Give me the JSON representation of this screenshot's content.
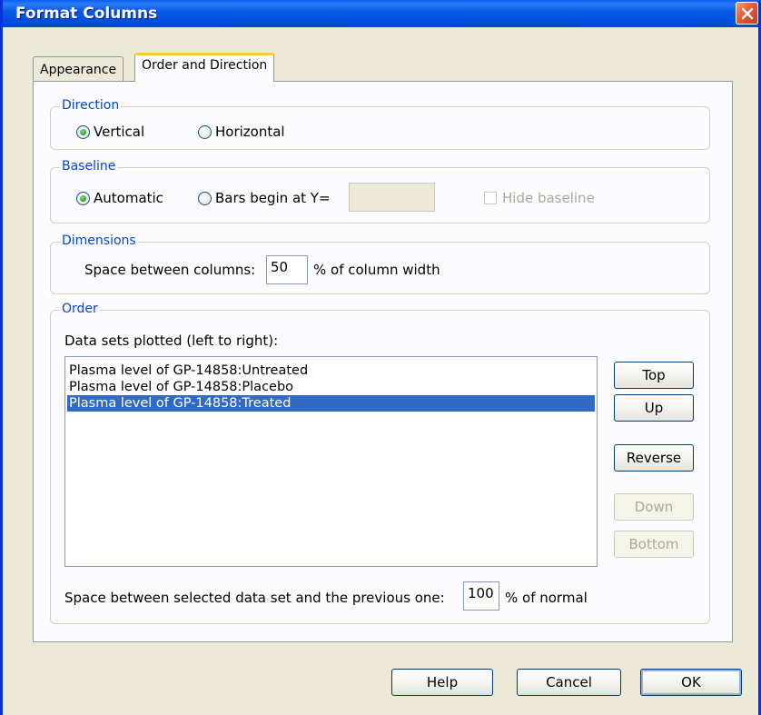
{
  "window": {
    "title": "Format Columns"
  },
  "tabs": [
    {
      "label": "Appearance",
      "active": false
    },
    {
      "label": "Order and Direction",
      "active": true
    }
  ],
  "direction": {
    "label": "Direction",
    "options": [
      {
        "label": "Vertical",
        "selected": true
      },
      {
        "label": "Horizontal",
        "selected": false
      }
    ]
  },
  "baseline": {
    "label": "Baseline",
    "automatic_label": "Automatic",
    "bars_begin_label": "Bars begin at Y=",
    "bars_begin_value": "",
    "hide_baseline_label": "Hide baseline",
    "selected": "Automatic"
  },
  "dimensions": {
    "label": "Dimensions",
    "space_label": "Space between columns:",
    "space_value": "50",
    "space_unit": "% of column width"
  },
  "order": {
    "label": "Order",
    "list_label": "Data sets plotted (left to right):",
    "items": [
      {
        "label": "Plasma level of GP-14858:Untreated",
        "selected": false
      },
      {
        "label": "Plasma level of GP-14858:Placebo",
        "selected": false
      },
      {
        "label": "Plasma level of GP-14858:Treated",
        "selected": true
      }
    ],
    "buttons": {
      "top": "Top",
      "up": "Up",
      "reverse": "Reverse",
      "down": "Down",
      "bottom": "Bottom"
    },
    "spacing_label": "Space between selected data set and the previous one:",
    "spacing_value": "100",
    "spacing_unit": "% of normal"
  },
  "footer": {
    "help": "Help",
    "cancel": "Cancel",
    "ok": "OK"
  },
  "colors": {
    "titlebar": "#0054e3",
    "group_label": "#0046d5",
    "selection": "#316ac5",
    "tab_highlight": "#ffc83c"
  }
}
